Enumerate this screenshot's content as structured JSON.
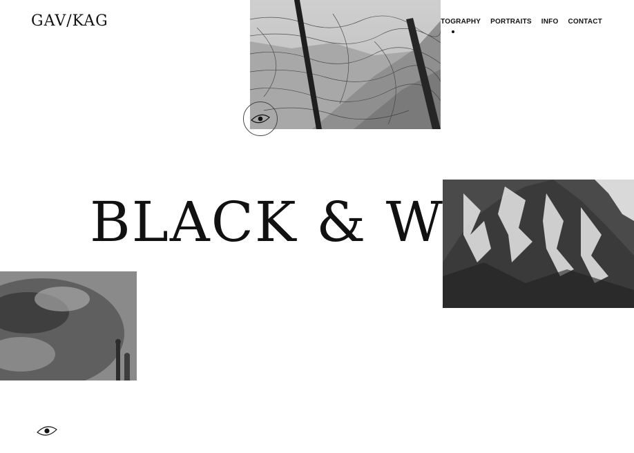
{
  "header": {
    "logo": "GAV/KAG",
    "nav": [
      {
        "label": "PHOTOGRAPHY",
        "active": true
      },
      {
        "label": "PORTRAITS",
        "active": false
      },
      {
        "label": "INFO",
        "active": false
      },
      {
        "label": "CONTACT",
        "active": false
      }
    ]
  },
  "hero": {
    "headline": "BLACK & WHITE"
  },
  "icons": {
    "cursor": "eye-icon",
    "bottom": "eye-icon"
  },
  "colors": {
    "background": "#ffffff",
    "text": "#111111"
  }
}
